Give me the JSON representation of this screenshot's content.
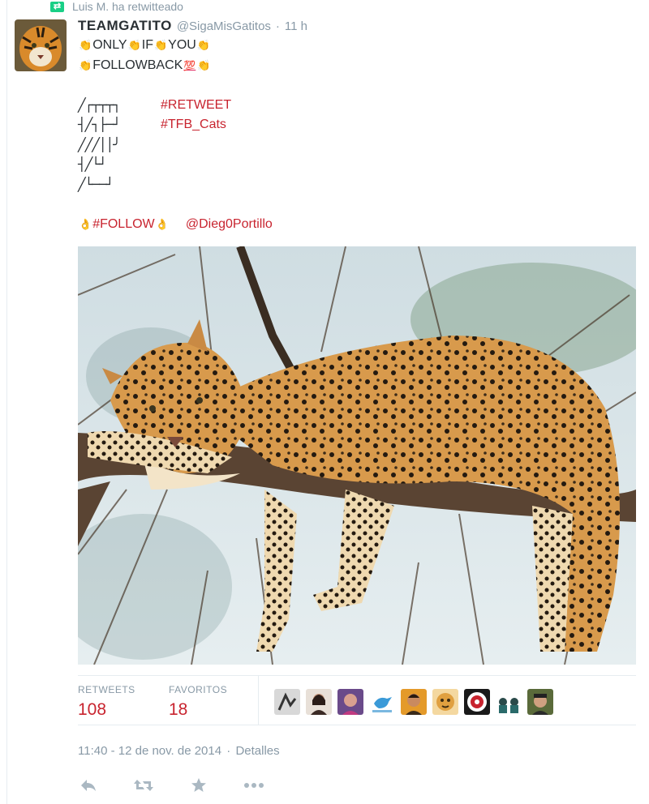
{
  "context": {
    "retweeted_by": "Luis M. ha retwitteado"
  },
  "tweet": {
    "display_name": "TEAMGATITO",
    "handle": "@SigaMisGatitos",
    "separator": "·",
    "time_ago": "11 h",
    "line1": [
      "ONLY",
      "IF",
      "YOU"
    ],
    "line2": "FOLLOWBACK",
    "hashtag_retweet": "#RETWEET",
    "hashtag_tfb": "#TFB_Cats",
    "hashtag_follow": "#FOLLOW",
    "mention": "@Dieg0Portillo"
  },
  "stats": {
    "retweets_label": "RETWEETS",
    "retweets_value": "108",
    "favorites_label": "FAVORITOS",
    "favorites_value": "18"
  },
  "footer": {
    "timestamp": "11:40 - 12 de nov. de 2014",
    "separator": "·",
    "details_link": "Detalles"
  },
  "icons": {
    "context": "retweet-icon",
    "actions": [
      "reply-icon",
      "retweet-icon",
      "favorite-icon",
      "more-icon"
    ]
  },
  "colors": {
    "link": "#c8242f",
    "meta": "#8899a6",
    "retweet_badge": "#19cf86"
  }
}
